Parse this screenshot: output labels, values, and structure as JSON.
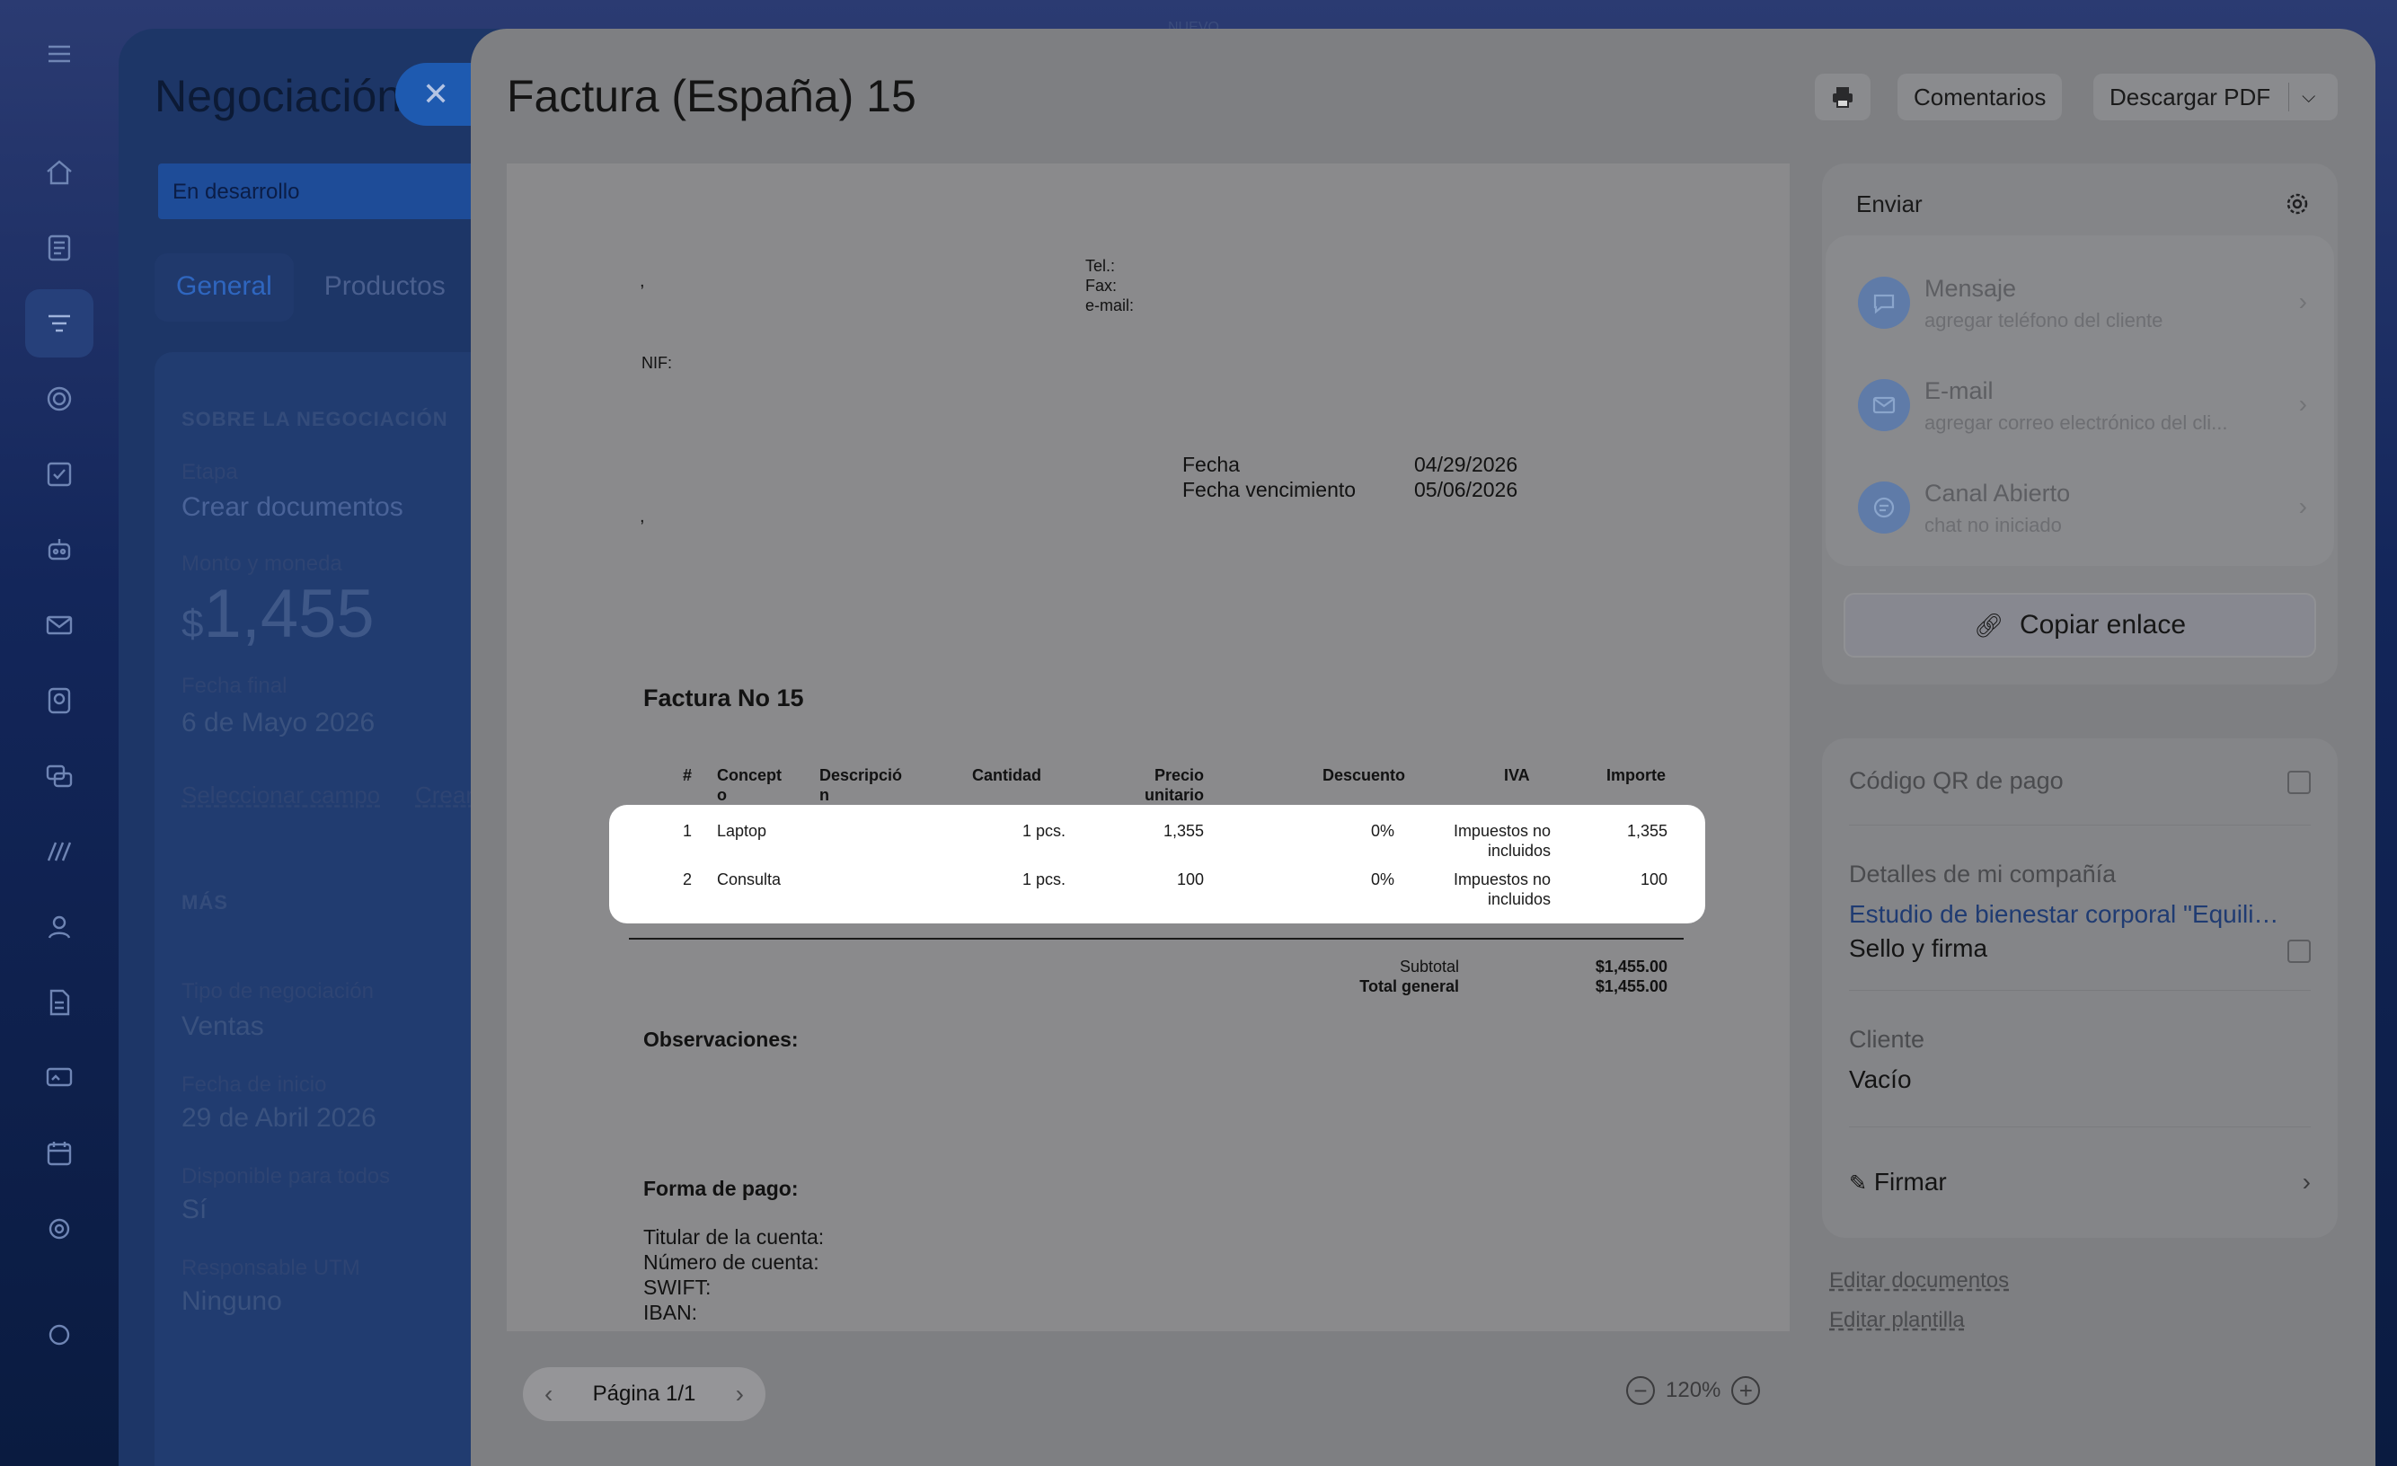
{
  "background_top_label": "NUEVO",
  "nav": {
    "icons": [
      "menu-icon",
      "home-icon",
      "feed-icon",
      "crm-funnel-icon",
      "target-icon",
      "tasks-icon",
      "robot-icon",
      "mail-icon",
      "contact-center-icon",
      "chat-icon",
      "sales-icon",
      "users-icon",
      "document-icon",
      "signature-icon",
      "calendar-icon",
      "settings-icon",
      "help-icon"
    ]
  },
  "deal": {
    "title": "Negociación",
    "status": "En desarrollo",
    "tabs": [
      "General",
      "Productos"
    ],
    "section_about": "SOBRE LA NEGOCIACIÓN",
    "stage_label": "Etapa",
    "stage_value": "Crear documentos",
    "amount_label": "Monto y moneda",
    "currency_symbol": "$",
    "amount": "1,455",
    "end_date_label": "Fecha final",
    "end_date": "6 de Mayo 2026",
    "select_field": "Seleccionar campo",
    "create_field": "Crear",
    "section_more": "MÁS",
    "deal_type_label": "Tipo de negociación",
    "deal_type": "Ventas",
    "start_date_label": "Fecha de inicio",
    "start_date": "29 de Abril 2026",
    "available_label": "Disponible para todos",
    "available": "Sí",
    "responsible_label": "Responsable UTM",
    "responsible": "Ninguno"
  },
  "slider": {
    "title": "Factura (España) 15",
    "comments_btn": "Comentarios",
    "download_btn": "Descargar PDF"
  },
  "invoice": {
    "comma1": ",",
    "tel": "Tel.:",
    "fax": "Fax:",
    "email": "e-mail:",
    "nif": "NIF:",
    "comma2": ",",
    "fecha_label": "Fecha",
    "fecha": "04/29/2026",
    "venc_label": "Fecha vencimiento",
    "venc": "05/06/2026",
    "heading": "Factura No 15",
    "columns": [
      "#",
      "Concept o",
      "Descripció n",
      "Cantidad",
      "Precio unitario",
      "Descuento",
      "IVA",
      "Importe"
    ],
    "rows": [
      {
        "n": "1",
        "concept": "Laptop",
        "qty": "1 pcs.",
        "price": "1,355",
        "disc": "0%",
        "iva": "Impuestos no incluidos",
        "amount": "1,355"
      },
      {
        "n": "2",
        "concept": "Consulta",
        "qty": "1 pcs.",
        "price": "100",
        "disc": "0%",
        "iva": "Impuestos no incluidos",
        "amount": "100"
      }
    ],
    "subtotal_label": "Subtotal",
    "subtotal": "$1,455.00",
    "total_label": "Total general",
    "total": "$1,455.00",
    "notes_label": "Observaciones:",
    "payment_label": "Forma de pago:",
    "holder": "Titular de la cuenta:",
    "account": "Número de cuenta:",
    "swift": "SWIFT:",
    "iban": "IBAN:"
  },
  "pager": {
    "label": "Página 1/1"
  },
  "zoom": {
    "value": "120%"
  },
  "send": {
    "title": "Enviar",
    "channels": [
      {
        "name": "Mensaje",
        "sub": "agregar teléfono del cliente",
        "icon": "message-icon"
      },
      {
        "name": "E-mail",
        "sub": "agregar correo electrónico del cli...",
        "icon": "email-icon"
      },
      {
        "name": "Canal Abierto",
        "sub": "chat no iniciado",
        "icon": "open-channel-icon"
      }
    ],
    "copy_link": "Copiar enlace"
  },
  "details": {
    "qr_label": "Código QR de pago",
    "company_label": "Detalles de mi compañía",
    "company": "Estudio de bienestar corporal \"Equilibrio\"",
    "stamp_label": "Sello y firma",
    "client_label": "Cliente",
    "client": "Vacío",
    "sign": "Firmar"
  },
  "links": {
    "edit_docs": "Editar documentos",
    "edit_template": "Editar plantilla"
  }
}
